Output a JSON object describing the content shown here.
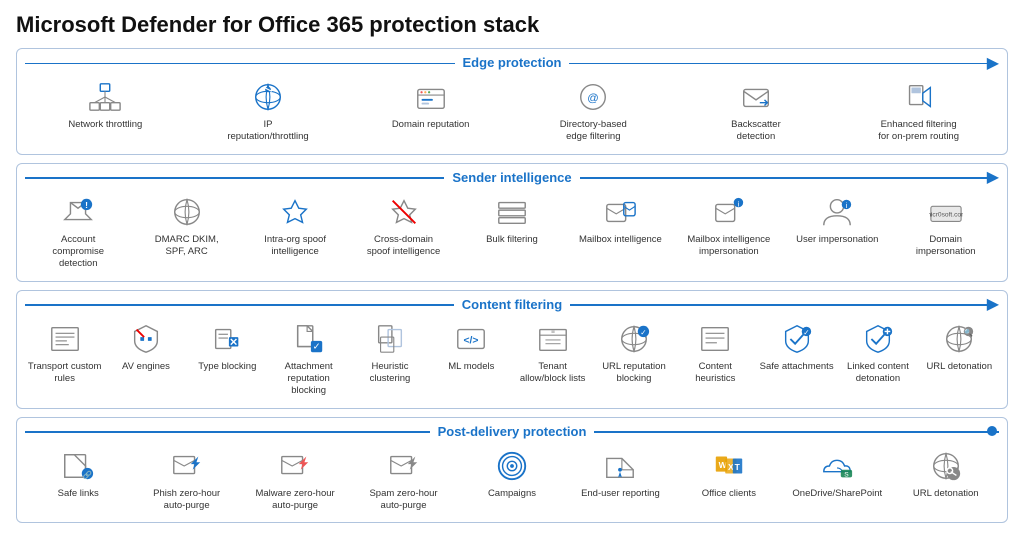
{
  "title": "Microsoft Defender for Office 365 protection stack",
  "sections": [
    {
      "id": "edge",
      "title": "Edge protection",
      "arrow": true,
      "dot": false,
      "items": [
        {
          "id": "network-throttling",
          "label": "Network throttling",
          "icon": "network"
        },
        {
          "id": "ip-reputation",
          "label": "IP reputation/throttling",
          "icon": "ip"
        },
        {
          "id": "domain-reputation",
          "label": "Domain reputation",
          "icon": "domain"
        },
        {
          "id": "directory-filtering",
          "label": "Directory-based edge filtering",
          "icon": "directory"
        },
        {
          "id": "backscatter",
          "label": "Backscatter detection",
          "icon": "backscatter"
        },
        {
          "id": "enhanced-filtering",
          "label": "Enhanced filtering for on-prem routing",
          "icon": "enhanced"
        }
      ]
    },
    {
      "id": "sender",
      "title": "Sender intelligence",
      "arrow": true,
      "dot": false,
      "items": [
        {
          "id": "account-compromise",
          "label": "Account compromise detection",
          "icon": "account"
        },
        {
          "id": "dmarc-dkim",
          "label": "DMARC DKIM, SPF, ARC",
          "icon": "dmarc"
        },
        {
          "id": "intra-org-spoof",
          "label": "Intra-org spoof intelligence",
          "icon": "intraorg"
        },
        {
          "id": "cross-domain-spoof",
          "label": "Cross-domain spoof intelligence",
          "icon": "crossdomain"
        },
        {
          "id": "bulk-filtering",
          "label": "Bulk filtering",
          "icon": "bulk"
        },
        {
          "id": "mailbox-intel",
          "label": "Mailbox intelligence",
          "icon": "mailbox"
        },
        {
          "id": "mailbox-impersonation",
          "label": "Mailbox intelligence impersonation",
          "icon": "mailboximp"
        },
        {
          "id": "user-impersonation",
          "label": "User impersonation",
          "icon": "user"
        },
        {
          "id": "domain-impersonation",
          "label": "Domain impersonation",
          "icon": "domainimp"
        }
      ]
    },
    {
      "id": "content",
      "title": "Content filtering",
      "arrow": true,
      "dot": false,
      "items": [
        {
          "id": "transport-rules",
          "label": "Transport custom rules",
          "icon": "transport"
        },
        {
          "id": "av-engines",
          "label": "AV engines",
          "icon": "av"
        },
        {
          "id": "type-blocking",
          "label": "Type blocking",
          "icon": "typblock"
        },
        {
          "id": "attachment-rep",
          "label": "Attachment reputation blocking",
          "icon": "attachment"
        },
        {
          "id": "heuristic",
          "label": "Heuristic clustering",
          "icon": "heuristic"
        },
        {
          "id": "ml-models",
          "label": "ML models",
          "icon": "ml"
        },
        {
          "id": "tenant-list",
          "label": "Tenant allow/block lists",
          "icon": "tenant"
        },
        {
          "id": "url-rep",
          "label": "URL reputation blocking",
          "icon": "urlrep"
        },
        {
          "id": "content-heuristics",
          "label": "Content heuristics",
          "icon": "contentheur"
        },
        {
          "id": "safe-attachments",
          "label": "Safe attachments",
          "icon": "safeatt"
        },
        {
          "id": "linked-content",
          "label": "Linked content detonation",
          "icon": "linkedcontent"
        },
        {
          "id": "url-detonation",
          "label": "URL detonation",
          "icon": "urldet"
        }
      ]
    },
    {
      "id": "postdelivery",
      "title": "Post-delivery protection",
      "arrow": false,
      "dot": true,
      "items": [
        {
          "id": "safe-links",
          "label": "Safe links",
          "icon": "safelinks"
        },
        {
          "id": "phish-zap",
          "label": "Phish zero-hour auto-purge",
          "icon": "phishzap"
        },
        {
          "id": "malware-zap",
          "label": "Malware zero-hour auto-purge",
          "icon": "malwarezap"
        },
        {
          "id": "spam-zap",
          "label": "Spam zero-hour auto-purge",
          "icon": "spamzap"
        },
        {
          "id": "campaigns",
          "label": "Campaigns",
          "icon": "campaigns"
        },
        {
          "id": "enduser-reporting",
          "label": "End-user reporting",
          "icon": "enduser"
        },
        {
          "id": "office-clients",
          "label": "Office clients",
          "icon": "office"
        },
        {
          "id": "onedrive-sharepoint",
          "label": "OneDrive/SharePoint",
          "icon": "onedrive"
        },
        {
          "id": "url-detonation-post",
          "label": "URL detonation",
          "icon": "urldetpost"
        }
      ]
    }
  ]
}
